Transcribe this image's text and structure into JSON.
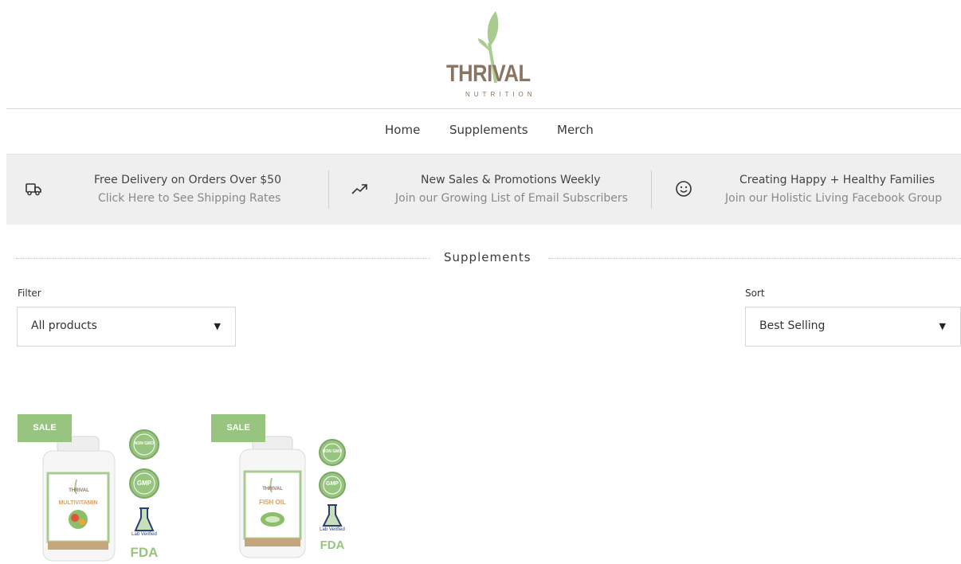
{
  "brand": {
    "name": "THRIVAL",
    "tagline": "NUTRITION"
  },
  "nav": {
    "items": [
      "Home",
      "Supplements",
      "Merch"
    ]
  },
  "banner": [
    {
      "icon": "truck-icon",
      "line1": "Free Delivery on Orders Over $50",
      "line2": "Click Here to See Shipping Rates"
    },
    {
      "icon": "trending-up-icon",
      "line1": "New Sales & Promotions Weekly",
      "line2": "Join our Growing List of Email Subscribers"
    },
    {
      "icon": "smiley-icon",
      "line1": "Creating Happy + Healthy Families",
      "line2": "Join our Holistic Living Facebook Group"
    }
  ],
  "collection": {
    "title": "Supplements"
  },
  "filter": {
    "label": "Filter",
    "value": "All products"
  },
  "sort": {
    "label": "Sort",
    "value": "Best Selling"
  },
  "products": [
    {
      "badge": "SALE",
      "bottle_label": "MULTIVITAMIN",
      "bottle_brand": "THRIVAL",
      "seals": [
        "NON GMO",
        "GMP",
        "Lab Verified",
        "FDA"
      ]
    },
    {
      "badge": "SALE",
      "bottle_label": "FISH OIL",
      "bottle_brand": "THRIVAL",
      "seals": [
        "NON GMO",
        "GMP",
        "Lab Verified",
        "FDA"
      ]
    }
  ],
  "colors": {
    "brand_brown": "#8a7562",
    "brand_green": "#97c47f",
    "banner_bg": "#efefef"
  }
}
